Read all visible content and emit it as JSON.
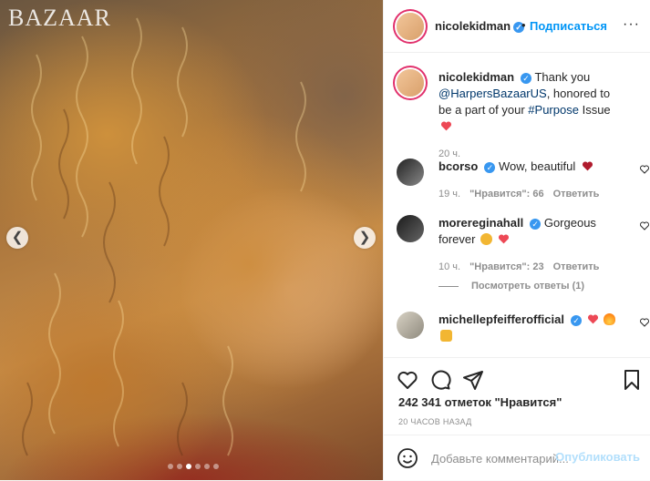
{
  "photo": {
    "brand": "BAZAAR",
    "carousel": {
      "total": 6,
      "active": 3
    }
  },
  "header": {
    "username": "nicolekidman",
    "dot": "•",
    "follow_label": "Подписаться",
    "more_icon": "more-horizontal-icon"
  },
  "caption": {
    "username": "nicolekidman",
    "text_1": "Thank you",
    "mention": "@HarpersBazaarUS",
    "text_2": ", honored to be a part of your",
    "hashtag": "#Purpose",
    "text_3": "Issue",
    "time": "20 ч."
  },
  "comments": [
    {
      "username": "bcorso",
      "text": "Wow, beautiful",
      "time": "19 ч.",
      "likes": "\"Нравится\": 66",
      "reply": "Ответить"
    },
    {
      "username": "morereginahall",
      "text": "Gorgeous forever",
      "time": "10 ч.",
      "likes": "\"Нравится\": 23",
      "reply": "Ответить",
      "view_replies": "Посмотреть ответы (1)"
    },
    {
      "username": "michellepfeifferofficial",
      "text": "",
      "time": "",
      "likes": "",
      "reply": ""
    }
  ],
  "likes_text": "242 341 отметок \"Нравится\"",
  "timestamp": "20 ЧАСОВ НАЗАД",
  "add_comment": {
    "placeholder": "Добавьте комментарий...",
    "post_label": "Опубликовать"
  },
  "colors": {
    "accent": "#0095f6",
    "verified": "#3897f0",
    "heart": "#ed4956"
  }
}
